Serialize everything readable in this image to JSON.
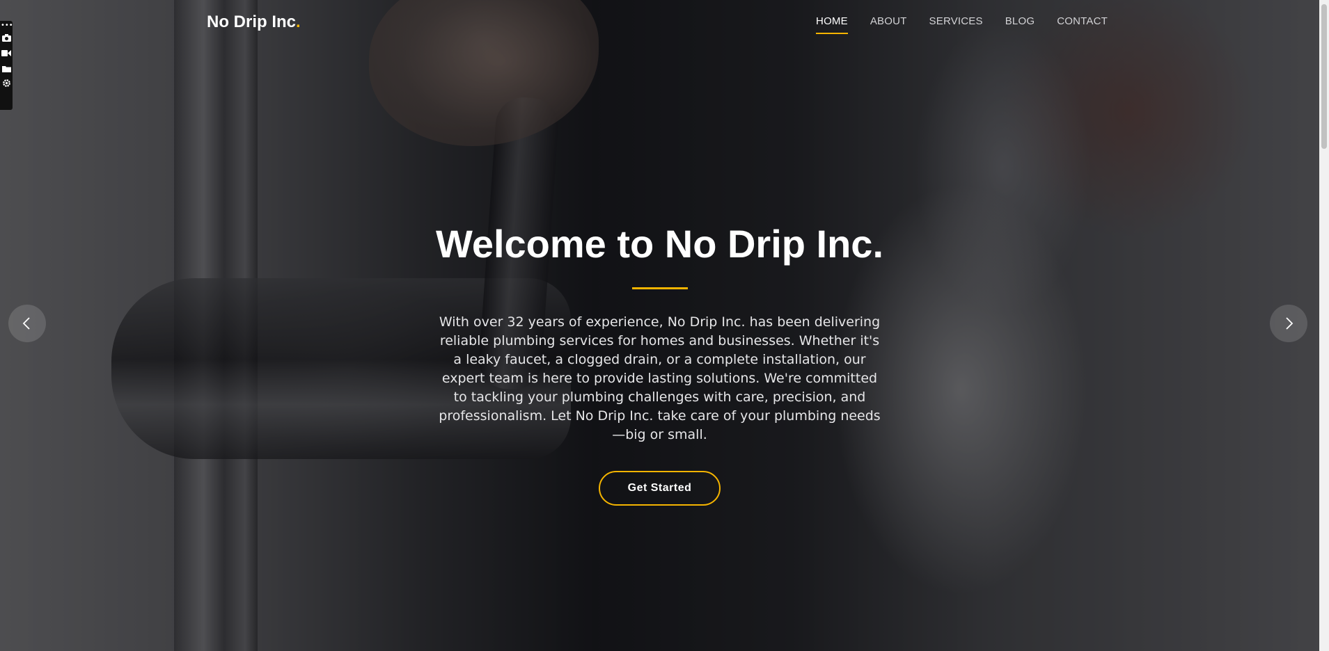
{
  "brand": {
    "name": "No Drip Inc",
    "dot": "."
  },
  "nav": {
    "items": [
      {
        "label": "HOME",
        "active": true
      },
      {
        "label": "ABOUT",
        "active": false
      },
      {
        "label": "SERVICES",
        "active": false
      },
      {
        "label": "BLOG",
        "active": false
      },
      {
        "label": "CONTACT",
        "active": false
      }
    ]
  },
  "hero": {
    "title": "Welcome to No Drip Inc.",
    "description": "With over 32 years of experience, No Drip Inc. has been delivering reliable plumbing services for homes and businesses. Whether it's a leaky faucet, a clogged drain, or a complete installation, our expert team is here to provide lasting solutions. We're committed to tackling your plumbing challenges with care, precision, and professionalism. Let No Drip Inc. take care of your plumbing needs—big or small.",
    "cta_label": "Get Started"
  },
  "carousel": {
    "prev_icon": "chevron-left-icon",
    "next_icon": "chevron-right-icon"
  },
  "toolbar": {
    "icons": [
      "more-icon",
      "camera-icon",
      "video-icon",
      "folder-icon",
      "gear-icon"
    ]
  },
  "colors": {
    "accent": "#f5b400",
    "text": "#ffffff"
  }
}
